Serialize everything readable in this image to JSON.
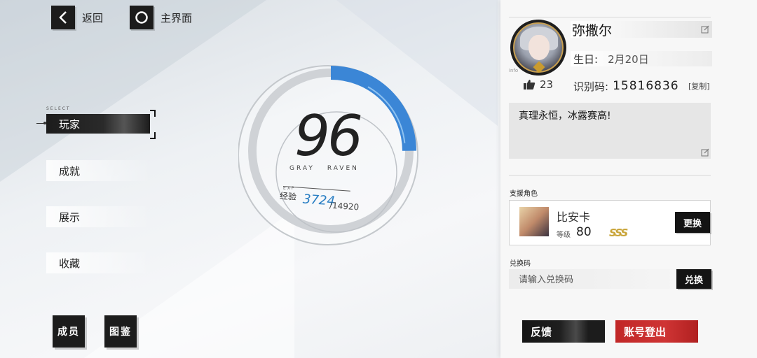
{
  "nav": {
    "back_label": "返回",
    "home_label": "主界面"
  },
  "menu": {
    "select_tag": "SELECT",
    "items": [
      {
        "label": "玩家",
        "active": true
      },
      {
        "label": "成就",
        "active": false
      },
      {
        "label": "展示",
        "active": false
      },
      {
        "label": "收藏",
        "active": false
      }
    ]
  },
  "bottom_left": {
    "members_label": "成员",
    "codex_label": "图鉴"
  },
  "level_display": {
    "level": "96",
    "team_word_1": "GRAY",
    "team_word_2": "RAVEN",
    "exp_tag": "EXP",
    "exp_label": "经验",
    "exp_current": "3724",
    "exp_max": "/14920",
    "exp_fraction": 0.2496,
    "accent_color": "#2a7fc4"
  },
  "profile": {
    "info_tag": "info",
    "name": "弥撒尔",
    "birthday_key": "生日:",
    "birthday_value": "2月20日",
    "likes": "23",
    "uid_key": "识别码:",
    "uid_value": "15816836",
    "copy_label": "[复制]",
    "signature": "真理永恒，冰露赛高!"
  },
  "support": {
    "section_label": "支援角色",
    "name": "比安卡",
    "level_key": "等级",
    "level": "80",
    "rank": "SSS",
    "change_label": "更换"
  },
  "redeem": {
    "section_label": "兑换码",
    "placeholder": "请输入兑换码",
    "button_label": "兑换"
  },
  "footer": {
    "feedback_label": "反馈",
    "logout_label": "账号登出"
  },
  "colors": {
    "logout_red": "#c12727",
    "dark": "#141414"
  }
}
